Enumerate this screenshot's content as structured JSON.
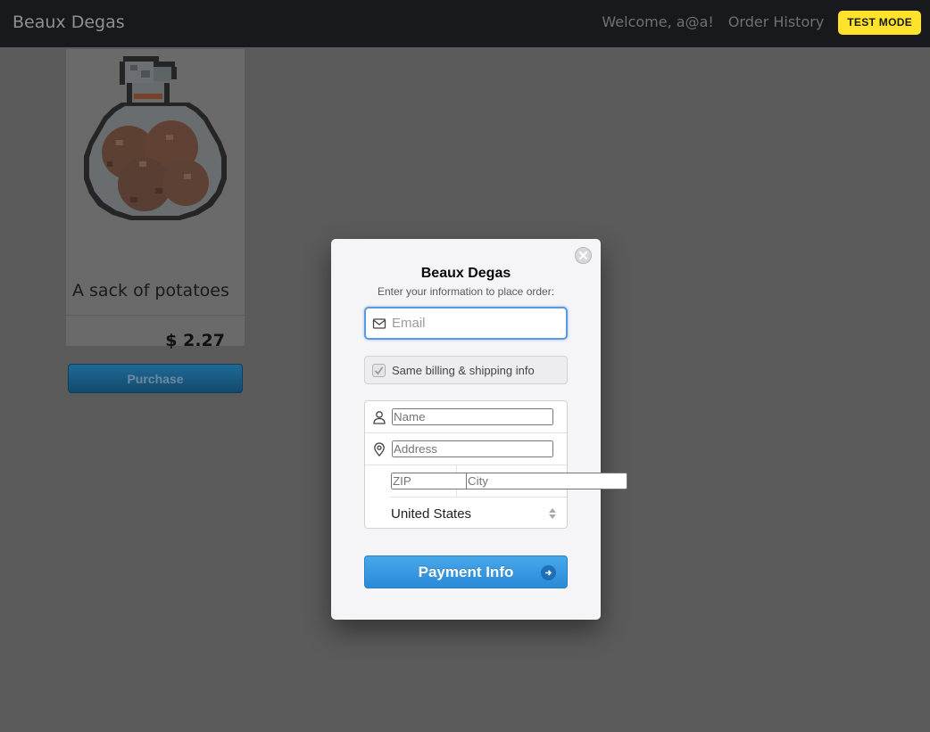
{
  "navbar": {
    "brand": "Beaux Degas",
    "welcome": "Welcome, a@a!",
    "order_history": "Order History",
    "test_mode": "TEST MODE"
  },
  "product": {
    "image_icon": "potato-sack-pixel-art",
    "title": "A sack of potatoes",
    "price": "$ 2.27",
    "purchase_label": "Purchase"
  },
  "checkout": {
    "title": "Beaux Degas",
    "subtitle": "Enter your information to place order:",
    "email": {
      "value": "",
      "placeholder": "Email"
    },
    "billing_label": "Same billing & shipping info",
    "billing_checked": true,
    "name": {
      "value": "",
      "placeholder": "Name"
    },
    "address": {
      "value": "",
      "placeholder": "Address"
    },
    "zip": {
      "value": "",
      "placeholder": "ZIP"
    },
    "city": {
      "value": "",
      "placeholder": "City"
    },
    "country": "United States",
    "submit_label": "Payment Info"
  },
  "colors": {
    "navbar_bg": "#17191d",
    "test_badge": "#ffe22b",
    "pay_button": "#3499e2",
    "overlay": "#5b5b5b"
  }
}
